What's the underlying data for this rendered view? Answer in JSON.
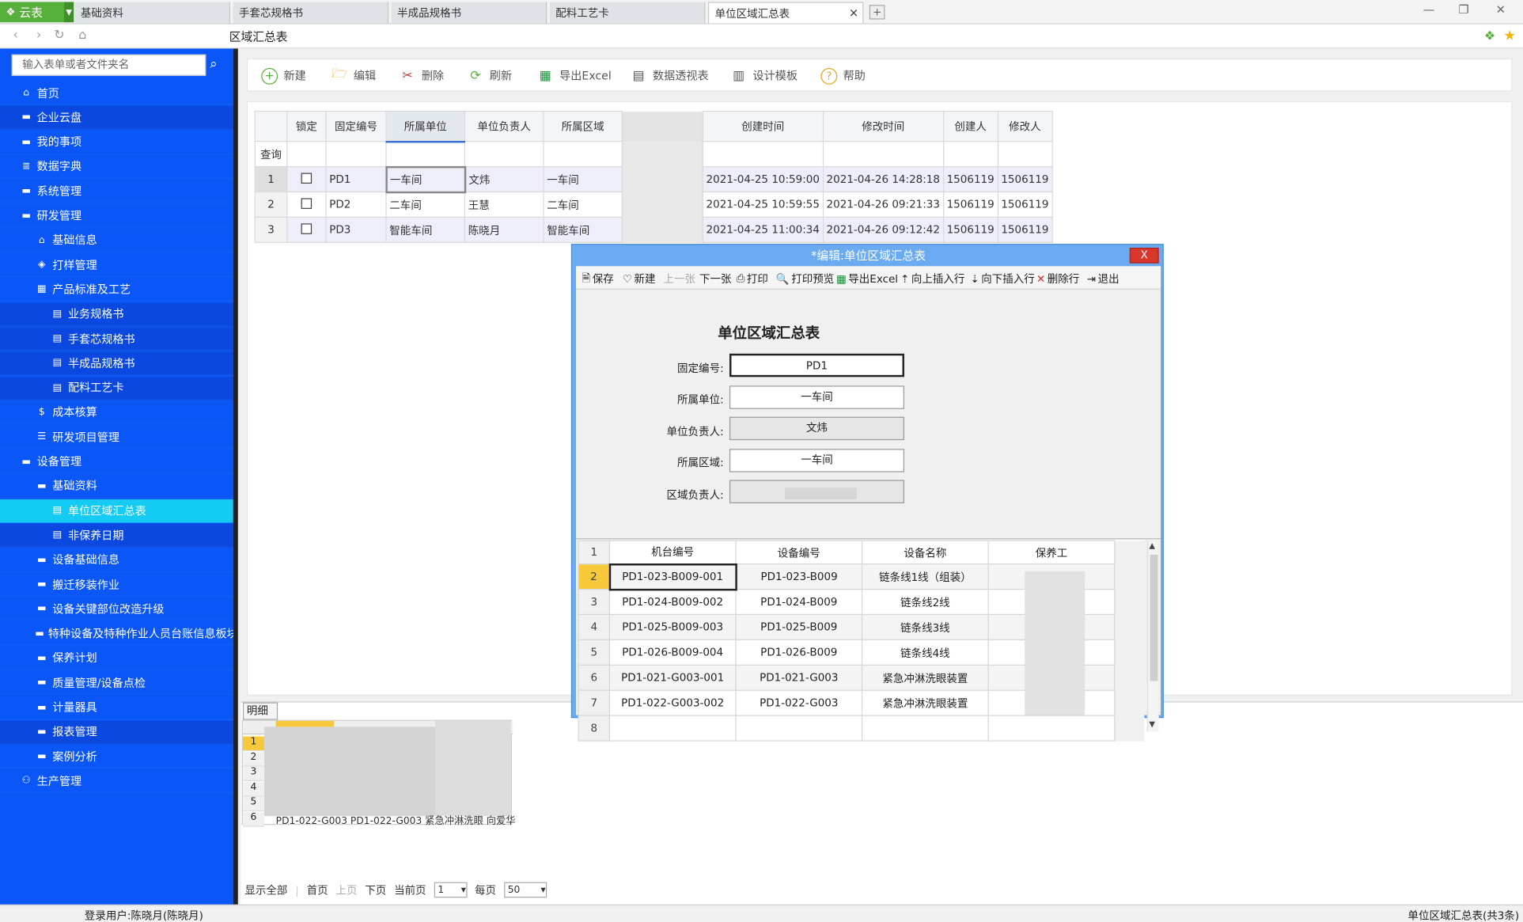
{
  "tabs": {
    "brand": "云表",
    "items": [
      "基础资料",
      "手套芯规格书",
      "半成品规格书",
      "配料工艺卡",
      "单位区域汇总表"
    ],
    "close": "×",
    "new": "+"
  },
  "window": {
    "min": "—",
    "restore": "❐",
    "close": "✕"
  },
  "address": {
    "title": "区域汇总表"
  },
  "sidebar": {
    "search_placeholder": "输入表单或者文件夹名",
    "items": [
      {
        "label": "首页",
        "icon": "home-icon"
      },
      {
        "label": "企业云盘",
        "icon": "folder-icon"
      },
      {
        "label": "我的事项",
        "icon": "folder-icon"
      },
      {
        "label": "数据字典",
        "icon": "database-icon"
      },
      {
        "label": "系统管理",
        "icon": "folder-icon"
      },
      {
        "label": "研发管理",
        "icon": "folder-icon"
      },
      {
        "label": "基础信息",
        "icon": "home-icon"
      },
      {
        "label": "打样管理",
        "icon": "cube-icon"
      },
      {
        "label": "产品标准及工艺",
        "icon": "table-icon"
      },
      {
        "label": "业务规格书",
        "icon": "doc-icon"
      },
      {
        "label": "手套芯规格书",
        "icon": "doc-icon"
      },
      {
        "label": "半成品规格书",
        "icon": "doc-icon"
      },
      {
        "label": "配料工艺卡",
        "icon": "doc-icon"
      },
      {
        "label": "成本核算",
        "icon": "money-icon"
      },
      {
        "label": "研发项目管理",
        "icon": "server-icon"
      },
      {
        "label": "设备管理",
        "icon": "folder-icon"
      },
      {
        "label": "基础资料",
        "icon": "folder-icon"
      },
      {
        "label": "单位区域汇总表",
        "icon": "doc-icon"
      },
      {
        "label": "非保养日期",
        "icon": "doc-icon"
      },
      {
        "label": "设备基础信息",
        "icon": "folder-icon"
      },
      {
        "label": "搬迁移装作业",
        "icon": "folder-icon"
      },
      {
        "label": "设备关键部位改造升级",
        "icon": "folder-icon"
      },
      {
        "label": "特种设备及特种作业人员台账信息板块",
        "icon": "folder-icon"
      },
      {
        "label": "保养计划",
        "icon": "folder-icon"
      },
      {
        "label": "质量管理/设备点检",
        "icon": "folder-icon"
      },
      {
        "label": "计量器具",
        "icon": "folder-icon"
      },
      {
        "label": "报表管理",
        "icon": "folder-icon"
      },
      {
        "label": "案例分析",
        "icon": "folder-icon"
      },
      {
        "label": "生产管理",
        "icon": "users-icon"
      }
    ]
  },
  "toolbar": {
    "new": "新建",
    "edit": "编辑",
    "delete": "删除",
    "refresh": "刷新",
    "export": "导出Excel",
    "pivot": "数据透视表",
    "design": "设计模板",
    "help": "帮助"
  },
  "grid": {
    "headers": [
      "锁定",
      "固定编号",
      "所属单位",
      "单位负责人",
      "所属区域",
      "创建时间",
      "修改时间",
      "创建人",
      "修改人"
    ],
    "query_label": "查询",
    "rows": [
      {
        "n": "1",
        "id": "PD1",
        "unit": "一车间",
        "lead": "文炜",
        "area": "一车间",
        "created": "2021-04-25 10:59:00",
        "modified": "2021-04-26 14:28:18",
        "creator": "1506119",
        "modifier": "1506119"
      },
      {
        "n": "2",
        "id": "PD2",
        "unit": "二车间",
        "lead": "王慧",
        "area": "二车间",
        "created": "2021-04-25 10:59:55",
        "modified": "2021-04-26 09:21:33",
        "creator": "1506119",
        "modifier": "1506119"
      },
      {
        "n": "3",
        "id": "PD3",
        "unit": "智能车间",
        "lead": "陈晓月",
        "area": "智能车间",
        "created": "2021-04-25 11:00:34",
        "modified": "2021-04-26 09:12:42",
        "creator": "1506119",
        "modifier": "1506119"
      }
    ]
  },
  "detail": {
    "tab": "明细",
    "row_nums": [
      "1",
      "2",
      "3",
      "4",
      "5",
      "6"
    ],
    "last_row": "PD1-022-G003 PD1-022-G003 紧急冲淋洗眼 向爱华"
  },
  "pager": {
    "show_all": "显示全部",
    "first": "首页",
    "prev": "上页",
    "next": "下页",
    "current_label": "当前页",
    "current": "1",
    "per_label": "每页",
    "per": "50"
  },
  "status": {
    "user": "登录用户:陈晓月(陈晓月)",
    "right": "单位区域汇总表(共3条)"
  },
  "dialog": {
    "title": "*编辑:单位区域汇总表",
    "close": "X",
    "toolbar": {
      "save": "保存",
      "new": "新建",
      "prev": "上一张",
      "next": "下一张",
      "print": "打印",
      "preview": "打印预览",
      "export": "导出Excel",
      "insert_up": "向上插入行",
      "insert_down": "向下插入行",
      "del_row": "删除行",
      "exit": "退出"
    },
    "form_title": "单位区域汇总表",
    "fields": [
      {
        "label": "固定编号:",
        "value": "PD1"
      },
      {
        "label": "所属单位:",
        "value": "一车间"
      },
      {
        "label": "单位负责人:",
        "value": "文炜"
      },
      {
        "label": "所属区域:",
        "value": "一车间"
      },
      {
        "label": "区域负责人:",
        "value": ""
      }
    ],
    "sub_headers": [
      "机台编号",
      "设备编号",
      "设备名称",
      "保养工"
    ],
    "sub_rows": [
      {
        "n": "2",
        "a": "PD1-023-B009-001",
        "b": "PD1-023-B009",
        "c": "链条线1线（组装）"
      },
      {
        "n": "3",
        "a": "PD1-024-B009-002",
        "b": "PD1-024-B009",
        "c": "链条线2线"
      },
      {
        "n": "4",
        "a": "PD1-025-B009-003",
        "b": "PD1-025-B009",
        "c": "链条线3线"
      },
      {
        "n": "5",
        "a": "PD1-026-B009-004",
        "b": "PD1-026-B009",
        "c": "链条线4线"
      },
      {
        "n": "6",
        "a": "PD1-021-G003-001",
        "b": "PD1-021-G003",
        "c": "紧急冲淋洗眼装置"
      },
      {
        "n": "7",
        "a": "PD1-022-G003-002",
        "b": "PD1-022-G003",
        "c": "紧急冲淋洗眼装置"
      }
    ],
    "sub_header_num": "1",
    "sub_last_num": "8"
  }
}
